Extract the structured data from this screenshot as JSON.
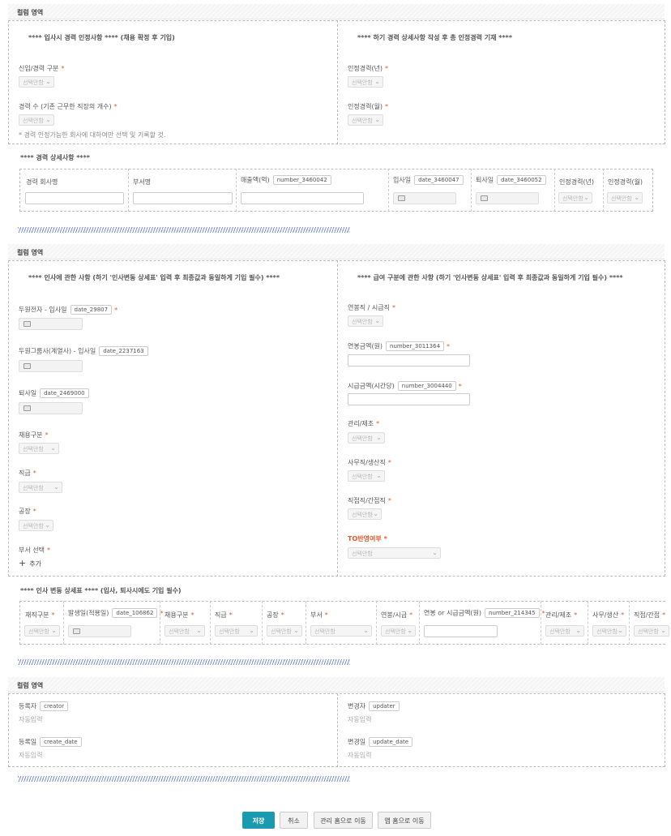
{
  "section1": {
    "header": "컬럼 영역",
    "left_note": "**** 입사시 경력 인정사항 **** (채용 확정 후 기입)",
    "right_note": "**** 하기 경력 상세사항 작성 후 총 인정경력 기재 ****",
    "career_type_label": "신입/경력 구분",
    "career_count_label": "경력 수 (기존 근무한 직장의 개수)",
    "career_hint": "* 경력 인정가능한 회사에 대하여만 선택 및 기록할 것.",
    "approved_years_label": "인정경력(년)",
    "approved_months_label": "인정경력(월)",
    "select_placeholder": "선택안함",
    "detail_title": "**** 경력 상세사항 ****",
    "table": {
      "col_company": "경력 회사명",
      "col_dept": "부서명",
      "col_sales": "매출액(억)",
      "col_sales_tag": "number_3460042",
      "col_join": "입사일",
      "col_join_tag": "date_3460047",
      "col_leave": "퇴사일",
      "col_leave_tag": "date_3460052",
      "col_years": "인정경력(년)",
      "col_months": "인정경력(월)"
    }
  },
  "section2": {
    "header": "컬럼 영역",
    "left_note": "**** 인사에 관한 사항 (하기 '인사변동 상세표' 입력 후 최종값과 동일하게 기입 필수) ****",
    "right_note": "**** 급여 구분에 관한 사항 (하기 '인사변동 상세표' 입력 후 최종값과 동일하게 기입 필수) ****",
    "doowon_join_label": "두원전자 - 입사일",
    "doowon_join_tag": "date_29807",
    "group_join_label": "두원그룹사(계열사) - 입사일",
    "group_join_tag": "date_2237163",
    "leave_label": "퇴사일",
    "leave_tag": "date_2469000",
    "hire_type_label": "채용구분",
    "rank_label": "직급",
    "factory_label": "공장",
    "dept_select_label": "부서 선택",
    "add_label": "추가",
    "salary_type_label": "연봉직 / 시급직",
    "salary_amount_label": "연봉금액(원)",
    "salary_amount_tag": "number_3011364",
    "hourly_amount_label": "시급금액(시간당)",
    "hourly_amount_tag": "number_3004440",
    "mgmt_label": "관리/제조",
    "office_label": "사무직/생산직",
    "direct_label": "직접직/간접직",
    "to_label": "TO반영여부",
    "select_placeholder": "선택안함",
    "change_title": "**** 인사 변동 상세표 **** (입사, 퇴사시에도 기입 필수)",
    "table": {
      "col_status": "재직구분",
      "col_date": "발생일(적용일)",
      "col_date_tag": "date_106862",
      "col_hire": "채용구분",
      "col_rank": "직급",
      "col_factory": "공장",
      "col_dept": "부서",
      "col_salary": "연봉/시급",
      "col_amount": "연봉 or 시급금액(원)",
      "col_amount_tag": "number_214345",
      "col_mgmt": "관리/제조",
      "col_office": "사무/생산",
      "col_direct": "직접/간접"
    }
  },
  "section3": {
    "header": "컬럼 영역",
    "creator_label": "등록자",
    "creator_tag": "creator",
    "created_label": "등록일",
    "created_tag": "create_date",
    "updater_label": "변경자",
    "updater_tag": "updater",
    "updated_label": "변경일",
    "updated_tag": "update_date",
    "auto_value": "자동입력"
  },
  "buttons": {
    "save": "저장",
    "cancel": "취소",
    "admin_home": "관리 홈으로 이동",
    "app_home": "앱 홈으로 이동"
  },
  "colors": {
    "accent": "#e05a2e",
    "primary": "#1a9ab0"
  }
}
